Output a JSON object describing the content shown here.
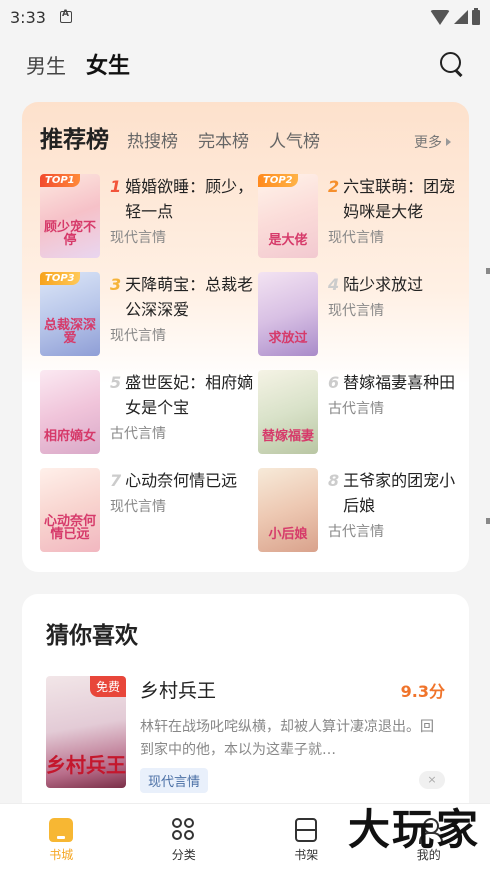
{
  "status": {
    "time": "3:33"
  },
  "top_nav": {
    "male": "男生",
    "female": "女生"
  },
  "ranking": {
    "title": "推荐榜",
    "tabs": [
      "热搜榜",
      "完本榜",
      "人气榜"
    ],
    "more": "更多",
    "items": [
      {
        "rank": "1",
        "tag": "TOP1",
        "name": "婚婚欲睡：顾少，轻一点",
        "genre": "现代言情",
        "cover_text": "顾少宠不停"
      },
      {
        "rank": "2",
        "tag": "TOP2",
        "name": "六宝联萌：团宠妈咪是大佬",
        "genre": "现代言情",
        "cover_text": "是大佬"
      },
      {
        "rank": "3",
        "tag": "TOP3",
        "name": "天降萌宝：总裁老公深深爱",
        "genre": "现代言情",
        "cover_text": "总裁深深爱"
      },
      {
        "rank": "4",
        "tag": "",
        "name": "陆少求放过",
        "genre": "现代言情",
        "cover_text": "求放过"
      },
      {
        "rank": "5",
        "tag": "",
        "name": "盛世医妃：相府嫡女是个宝",
        "genre": "古代言情",
        "cover_text": "相府嫡女"
      },
      {
        "rank": "6",
        "tag": "",
        "name": "替嫁福妻喜种田",
        "genre": "古代言情",
        "cover_text": "替嫁福妻"
      },
      {
        "rank": "7",
        "tag": "",
        "name": "心动奈何情已远",
        "genre": "现代言情",
        "cover_text": "心动奈何情已远"
      },
      {
        "rank": "8",
        "tag": "",
        "name": "王爷家的团宠小后娘",
        "genre": "古代言情",
        "cover_text": "小后娘"
      }
    ]
  },
  "guess": {
    "title": "猜你喜欢",
    "book": {
      "name": "乡村兵王",
      "score": "9.3分",
      "badge": "免费",
      "cover_text": "乡村兵王",
      "desc": "林轩在战场叱咤纵横，却被人算计凄凉退出。回到家中的他，本以为这辈子就…",
      "genre": "现代言情",
      "dismiss": "×"
    }
  },
  "bottom_nav": {
    "items": [
      "书城",
      "分类",
      "书架",
      "我的"
    ],
    "active": "书城"
  },
  "watermark": "大玩家",
  "colors": {
    "accent": "#f5a623",
    "score": "#f0742b",
    "rank1": "#f2543a"
  }
}
